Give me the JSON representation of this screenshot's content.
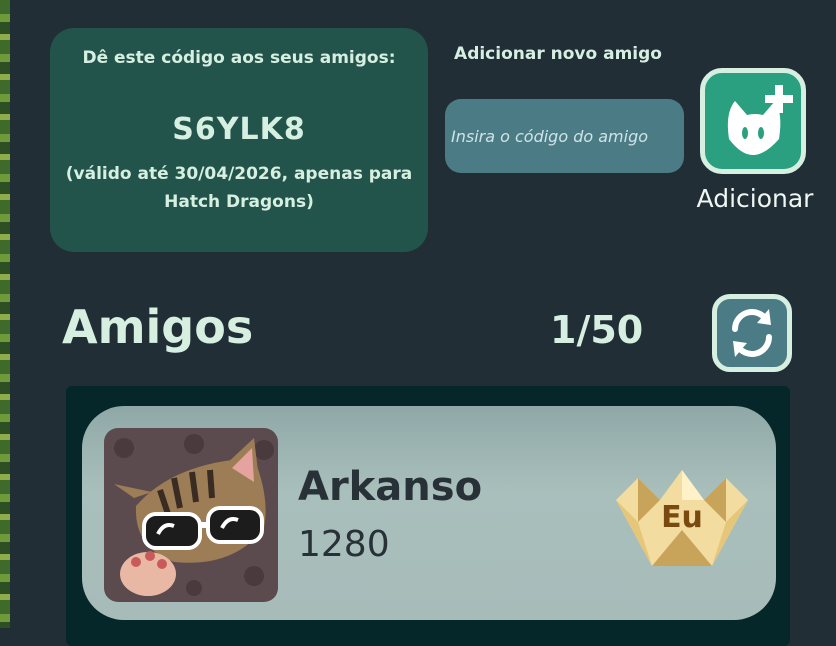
{
  "share": {
    "caption": "Dê este código aos seus amigos:",
    "code": "S6YLK8",
    "validity": "(válido até 30/04/2026, apenas para Hatch Dragons)"
  },
  "add_friend": {
    "title": "Adicionar novo amigo",
    "input_placeholder": "Insira o código do amigo",
    "input_value": "",
    "button_label": "Adicionar",
    "button_icon": "add-friend-cat-icon"
  },
  "friends": {
    "title": "Amigos",
    "count": "1/50",
    "refresh_icon": "refresh-icon",
    "list": [
      {
        "name": "Arkanso",
        "score": "1280",
        "badge": "Eu",
        "avatar": "cat-with-sunglasses-avatar"
      }
    ]
  },
  "colors": {
    "background": "#222e36",
    "card_green": "#23544b",
    "accent_text": "#d6efe1",
    "button_green": "#2ba080",
    "button_teal": "#4b7c86",
    "friend_card": "#a7bcb9"
  }
}
